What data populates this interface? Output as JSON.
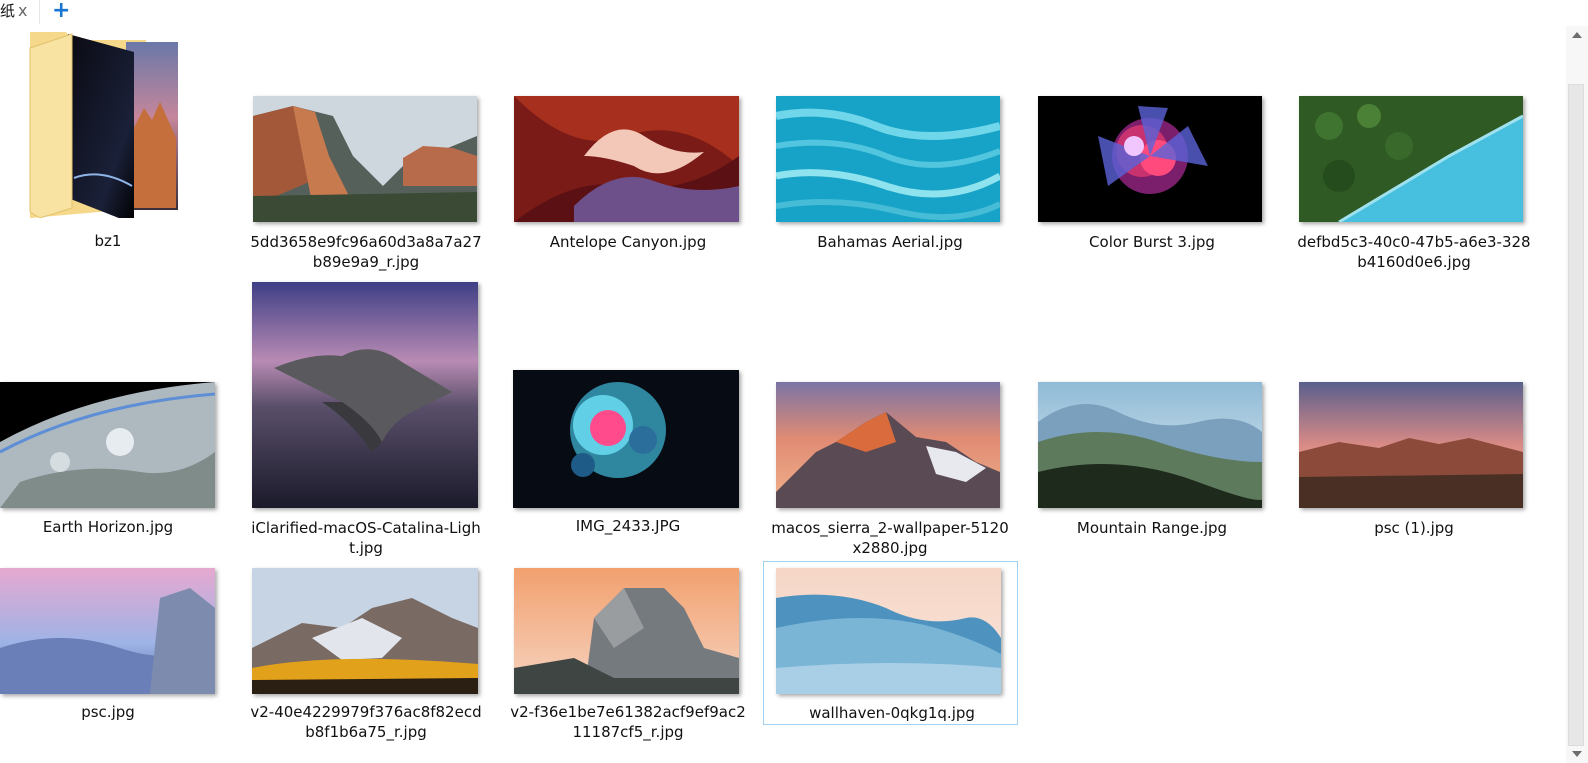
{
  "tab": {
    "title": "纸",
    "close_label": "x",
    "new_tab_label": "+"
  },
  "folder": {
    "name": "bz1"
  },
  "files": [
    {
      "name": "5dd3658e9fc96a60d3a8a7a27b89e9a9_r.jpg"
    },
    {
      "name": "Antelope Canyon.jpg"
    },
    {
      "name": "Bahamas Aerial.jpg"
    },
    {
      "name": "Color Burst 3.jpg"
    },
    {
      "name": "defbd5c3-40c0-47b5-a6e3-328b4160d0e6.jpg"
    },
    {
      "name": "Earth Horizon.jpg"
    },
    {
      "name": "iClarified-macOS-Catalina-Light.jpg"
    },
    {
      "name": "IMG_2433.JPG"
    },
    {
      "name": "macos_sierra_2-wallpaper-5120x2880.jpg"
    },
    {
      "name": "Mountain Range.jpg"
    },
    {
      "name": "psc (1).jpg"
    },
    {
      "name": "psc.jpg"
    },
    {
      "name": "v2-40e4229979f376ac8f82ecdb8f1b6a75_r.jpg"
    },
    {
      "name": "v2-f36e1be7e61382acf9ef9ac211187cf5_r.jpg"
    },
    {
      "name": "wallhaven-0qkg1q.jpg"
    }
  ],
  "selected_file": "wallhaven-0qkg1q.jpg"
}
